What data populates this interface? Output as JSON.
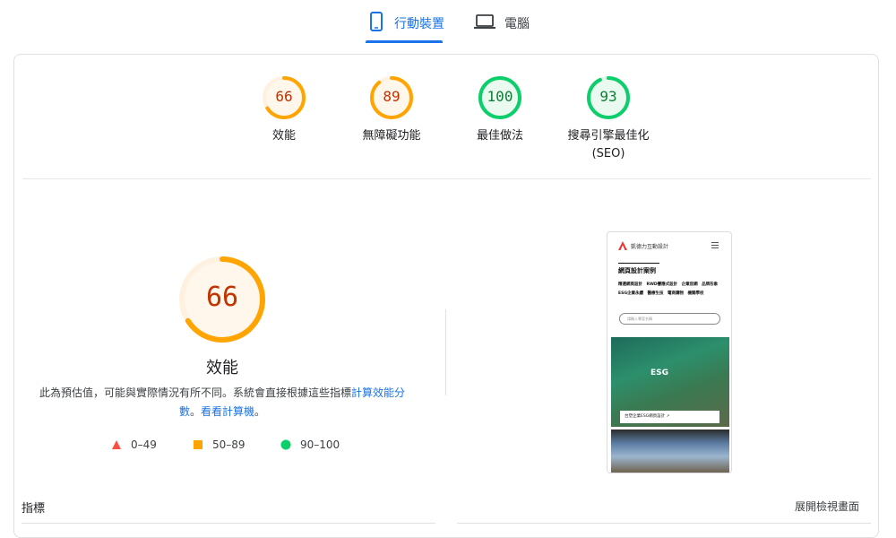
{
  "tabs": [
    {
      "label": "行動裝置",
      "icon": "phone-icon",
      "active": true
    },
    {
      "label": "電腦",
      "icon": "laptop-icon",
      "active": false
    }
  ],
  "scores": [
    {
      "value": "66",
      "label": "效能",
      "label2": "",
      "fraction": 0.66,
      "color": "#ffa400"
    },
    {
      "value": "89",
      "label": "無障礙功能",
      "label2": "",
      "fraction": 0.89,
      "color": "#ffa400"
    },
    {
      "value": "100",
      "label": "最佳做法",
      "label2": "",
      "fraction": 1.0,
      "color": "#0cce6b"
    },
    {
      "value": "93",
      "label": "搜尋引擎最佳化",
      "label2": "(SEO)",
      "fraction": 0.93,
      "color": "#0cce6b"
    }
  ],
  "performance": {
    "value": "66",
    "fraction": 0.66,
    "title": "效能",
    "desc_prefix": "此為預估值，可能與實際情況有所不同。系統會直接根據這些指標",
    "desc_link1": "計算效能分數",
    "desc_mid": "。",
    "desc_link2": "看看計算機",
    "desc_end": "。"
  },
  "legend": [
    {
      "range": "0–49",
      "shape": "triangle",
      "color": "#ff4e42"
    },
    {
      "range": "50–89",
      "shape": "square",
      "color": "#ffa400"
    },
    {
      "range": "90–100",
      "shape": "circle",
      "color": "#0cce6b"
    }
  ],
  "screenshot": {
    "brand": "凱德力互動設計",
    "title": "網頁設計案例",
    "links": "精選網頁設計　RWD響應式設計　企業官網　品牌形象　ESG企業永續　醫療生技　電商購物　機關學校",
    "search_placeholder": "請輸入專案名稱",
    "img_label": "ESG",
    "caption": "台塑企業ESG網頁設計 ↗"
  },
  "metrics": {
    "title": "指標",
    "expand_label": "展開檢視畫面"
  }
}
